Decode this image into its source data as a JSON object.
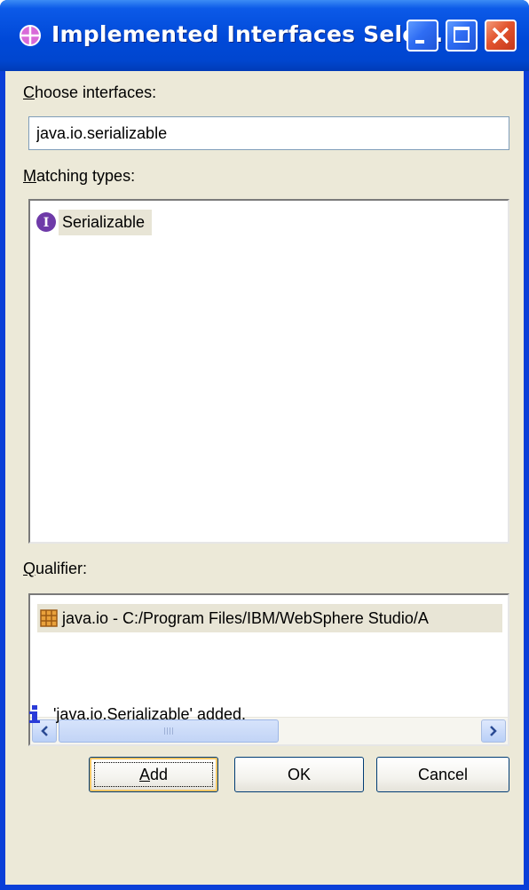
{
  "window": {
    "title": "Implemented Interfaces Sele...",
    "title_icon": "crosshair-circle-icon",
    "controls": [
      "minimize-icon",
      "maximize-icon",
      "close-icon"
    ]
  },
  "choose": {
    "label_accel": "C",
    "label_rest": "hoose interfaces:",
    "value": "java.io.serializable"
  },
  "matching": {
    "label_accel": "M",
    "label_rest": "atching types:",
    "items": [
      {
        "icon": "interface-icon",
        "text": "Serializable",
        "selected": true
      }
    ]
  },
  "qualifier": {
    "label_accel": "Q",
    "label_rest": "ualifier:",
    "items": [
      {
        "icon": "package-icon",
        "text": "java.io - C:/Program Files/IBM/WebSphere Studio/A",
        "selected": true
      }
    ]
  },
  "status": {
    "icon": "info-icon",
    "text": "'java.io.Serializable' added."
  },
  "buttons": {
    "add_accel": "A",
    "add_rest": "dd",
    "ok": "OK",
    "cancel": "Cancel"
  },
  "colors": {
    "titlebar": "#0a4be0",
    "dialog_bg": "#ece9d8",
    "selection": "#e8e5d6",
    "info": "#2a3bd8",
    "interface_badge": "#6e3aa8"
  }
}
